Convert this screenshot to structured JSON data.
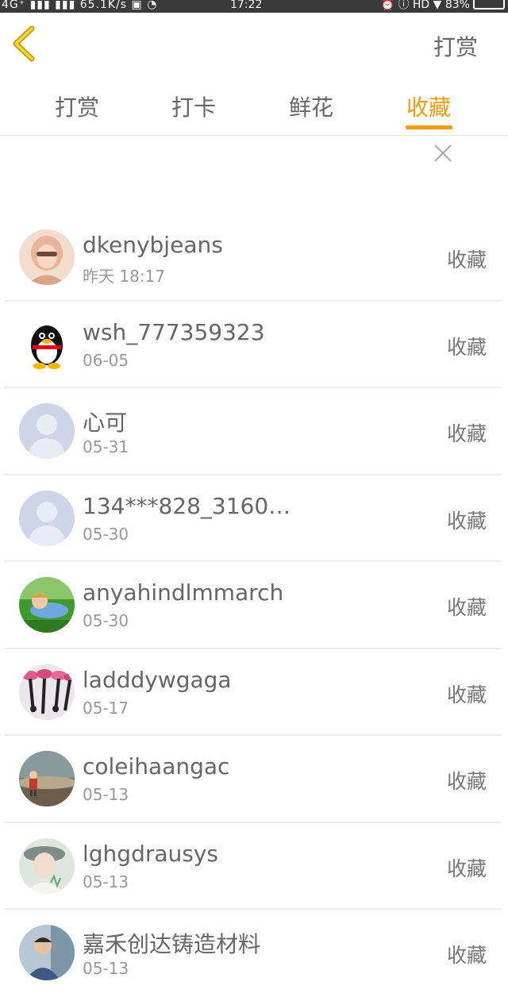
{
  "status_bar": {
    "left": "4G⁺ ▮▮▮ ▮▮▮ 65.1K/s ▣ ◔",
    "time": "17:22",
    "right": "⏰ ⓘ HD ▼ 83%"
  },
  "header": {
    "action_label": "打赏"
  },
  "tabs": [
    {
      "label": "打赏"
    },
    {
      "label": "打卡"
    },
    {
      "label": "鲜花"
    },
    {
      "label": "收藏",
      "active": true
    }
  ],
  "colors": {
    "accent": "#f39c12",
    "back_icon": "#c9a100",
    "text": "#666666",
    "subtext": "#999999"
  },
  "list": [
    {
      "name": "dkenybjeans",
      "date": "昨天 18:17",
      "action": "收藏",
      "avatar": "photo-girl-icon"
    },
    {
      "name": "wsh_777359323",
      "date": "06-05",
      "action": "收藏",
      "avatar": "qq-penguin-icon"
    },
    {
      "name": "心可",
      "date": "05-31",
      "action": "收藏",
      "avatar": "default-avatar-icon"
    },
    {
      "name": "134***828_3160…",
      "date": "05-30",
      "action": "收藏",
      "avatar": "default-avatar-icon"
    },
    {
      "name": "anyahindlmmarch",
      "date": "05-30",
      "action": "收藏",
      "avatar": "photo-child-grass-icon"
    },
    {
      "name": "ladddywgaga",
      "date": "05-17",
      "action": "收藏",
      "avatar": "photo-flowers-icon"
    },
    {
      "name": "coleihaangac",
      "date": "05-13",
      "action": "收藏",
      "avatar": "photo-child-sky-icon"
    },
    {
      "name": "lghgdrausys",
      "date": "05-13",
      "action": "收藏",
      "avatar": "photo-girl-hat-icon"
    },
    {
      "name": "嘉禾创达铸造材料",
      "date": "05-13",
      "action": "收藏",
      "avatar": "photo-person-icon"
    }
  ]
}
